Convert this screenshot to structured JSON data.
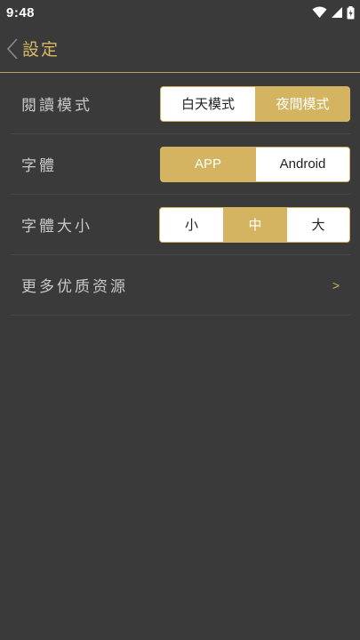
{
  "status_bar": {
    "time": "9:48"
  },
  "app_bar": {
    "title": "設定"
  },
  "settings": {
    "reading_mode": {
      "label": "閱讀模式",
      "options": [
        "白天模式",
        "夜間模式"
      ],
      "selected": "夜間模式"
    },
    "font": {
      "label": "字體",
      "options": [
        "APP",
        "Android"
      ],
      "selected": "APP"
    },
    "font_size": {
      "label": "字體大小",
      "options": [
        "小",
        "中",
        "大"
      ],
      "selected": "中"
    },
    "more": {
      "label": "更多优质资源",
      "chevron": ">"
    }
  },
  "colors": {
    "background": "#3a3a3a",
    "accent": "#d4b461",
    "title": "#d9b866"
  }
}
